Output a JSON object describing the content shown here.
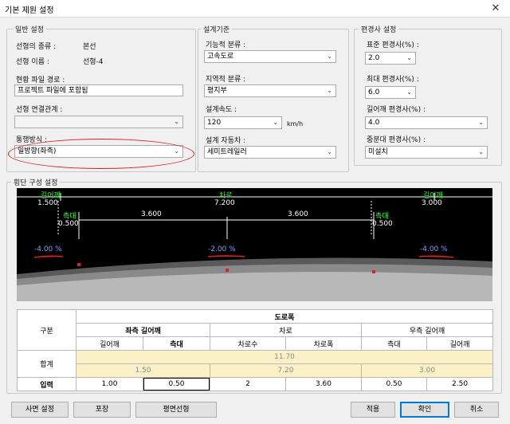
{
  "window": {
    "title": "기본 제원 설정",
    "close_glyph": "✕"
  },
  "general": {
    "group_label": "일반 설정",
    "alignment_type_label": "선형의 종류 :",
    "alignment_type_value": "본선",
    "alignment_name_label": "선형 이름 :",
    "alignment_name_value": "선형-4",
    "file_path_label": "현황 파일 경로 :",
    "file_path_value": "프로젝트 파일에 포함됨",
    "link_label": "선형 연결관계 :",
    "link_value": "",
    "traffic_label": "통행방식 :",
    "traffic_value": "일방향(좌측)"
  },
  "design": {
    "group_label": "설계기준",
    "function_label": "기능적 분류 :",
    "function_value": "고속도로",
    "region_label": "지역적 분류 :",
    "region_value": "평지부",
    "speed_label": "설계속도 :",
    "speed_value": "120",
    "speed_unit": "km/h",
    "vehicle_label": "설계 자동차 :",
    "vehicle_value": "세미트레일러"
  },
  "slope": {
    "group_label": "편경사 설정",
    "standard_label": "표준 편경사(%) :",
    "standard_value": "2.0",
    "max_label": "최대 편경사(%) :",
    "max_value": "6.0",
    "shoulder_label": "길어깨 편경사(%) :",
    "shoulder_value": "4.0",
    "median_label": "중분대 편경사(%) :",
    "median_value": "미설치"
  },
  "cross_section": {
    "group_label": "횡단 구성 설정",
    "top_left_label": "길어깨",
    "top_left_value": "1.500",
    "top_center_label": "차로",
    "top_center_value": "7.200",
    "top_right_label": "길어깨",
    "top_right_value": "3.000",
    "left_strip_label": "측대",
    "left_strip_value": "0.500",
    "lane1_value": "3.600",
    "lane2_value": "3.600",
    "right_strip_label": "측대",
    "right_strip_value": "0.500",
    "slope_left": "-4.00 %",
    "slope_center": "-2.00 %",
    "slope_right": "-4.00 %"
  },
  "table": {
    "header_group": "구분",
    "header_road_width": "도로폭",
    "header_left_shoulder": "좌측 길어깨",
    "header_lane": "차로",
    "header_right_shoulder": "우측 길어깨",
    "sub_shoulder": "길어깨",
    "sub_strip": "측대",
    "sub_lane_count": "차로수",
    "sub_lane_width": "차로폭",
    "sub_strip2": "측대",
    "sub_shoulder2": "길어깨",
    "total_label": "합계",
    "total_all": "11.70",
    "total_left": "1.50",
    "total_lane": "7.20",
    "total_right": "3.00",
    "input_label": "입력",
    "input_values": [
      "1.00",
      "0.50",
      "2",
      "3.60",
      "0.50",
      "2.50"
    ]
  },
  "buttons": {
    "slope_setting": "사면 설정",
    "pavement": "포장",
    "plan_alignment": "평면선형",
    "apply": "적용",
    "ok": "확인",
    "cancel": "취소"
  },
  "icons": {
    "dropdown": "chevron-down-icon"
  },
  "colors": {
    "highlight_ellipse": "#e02020",
    "dim_green": "#33ff33",
    "slope_blue": "#7fa0ff"
  }
}
